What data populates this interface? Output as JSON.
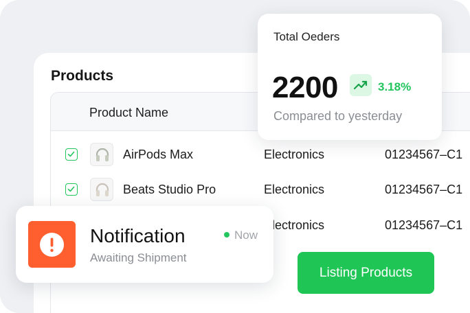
{
  "colors": {
    "accent_green": "#1fc655",
    "trend_green": "#22c55e",
    "alert_orange": "#ff5f2e",
    "backdrop": "#eef0f3"
  },
  "products": {
    "title": "Products",
    "columns": {
      "name": "Product Name"
    },
    "rows": [
      {
        "checked": true,
        "thumb_icon": "headphones-icon",
        "name": "AirPods Max",
        "category": "Electronics",
        "sku": "01234567–C1"
      },
      {
        "checked": true,
        "thumb_icon": "headphones-icon",
        "name": "Beats Studio Pro",
        "category": "Electronics",
        "sku": "01234567–C1"
      },
      {
        "checked": false,
        "thumb_icon": "",
        "name": "",
        "category": "Electronics",
        "sku": "01234567–C1"
      }
    ]
  },
  "orders": {
    "title": "Total Oeders",
    "value": "2200",
    "trend_icon": "trend-up-icon",
    "change": "3.18%",
    "caption": "Compared to yesterday"
  },
  "notification": {
    "icon": "alert-icon",
    "title": "Notification",
    "subtitle": "Awaiting Shipment",
    "time": "Now"
  },
  "actions": {
    "listing_label": "Listing Products"
  }
}
